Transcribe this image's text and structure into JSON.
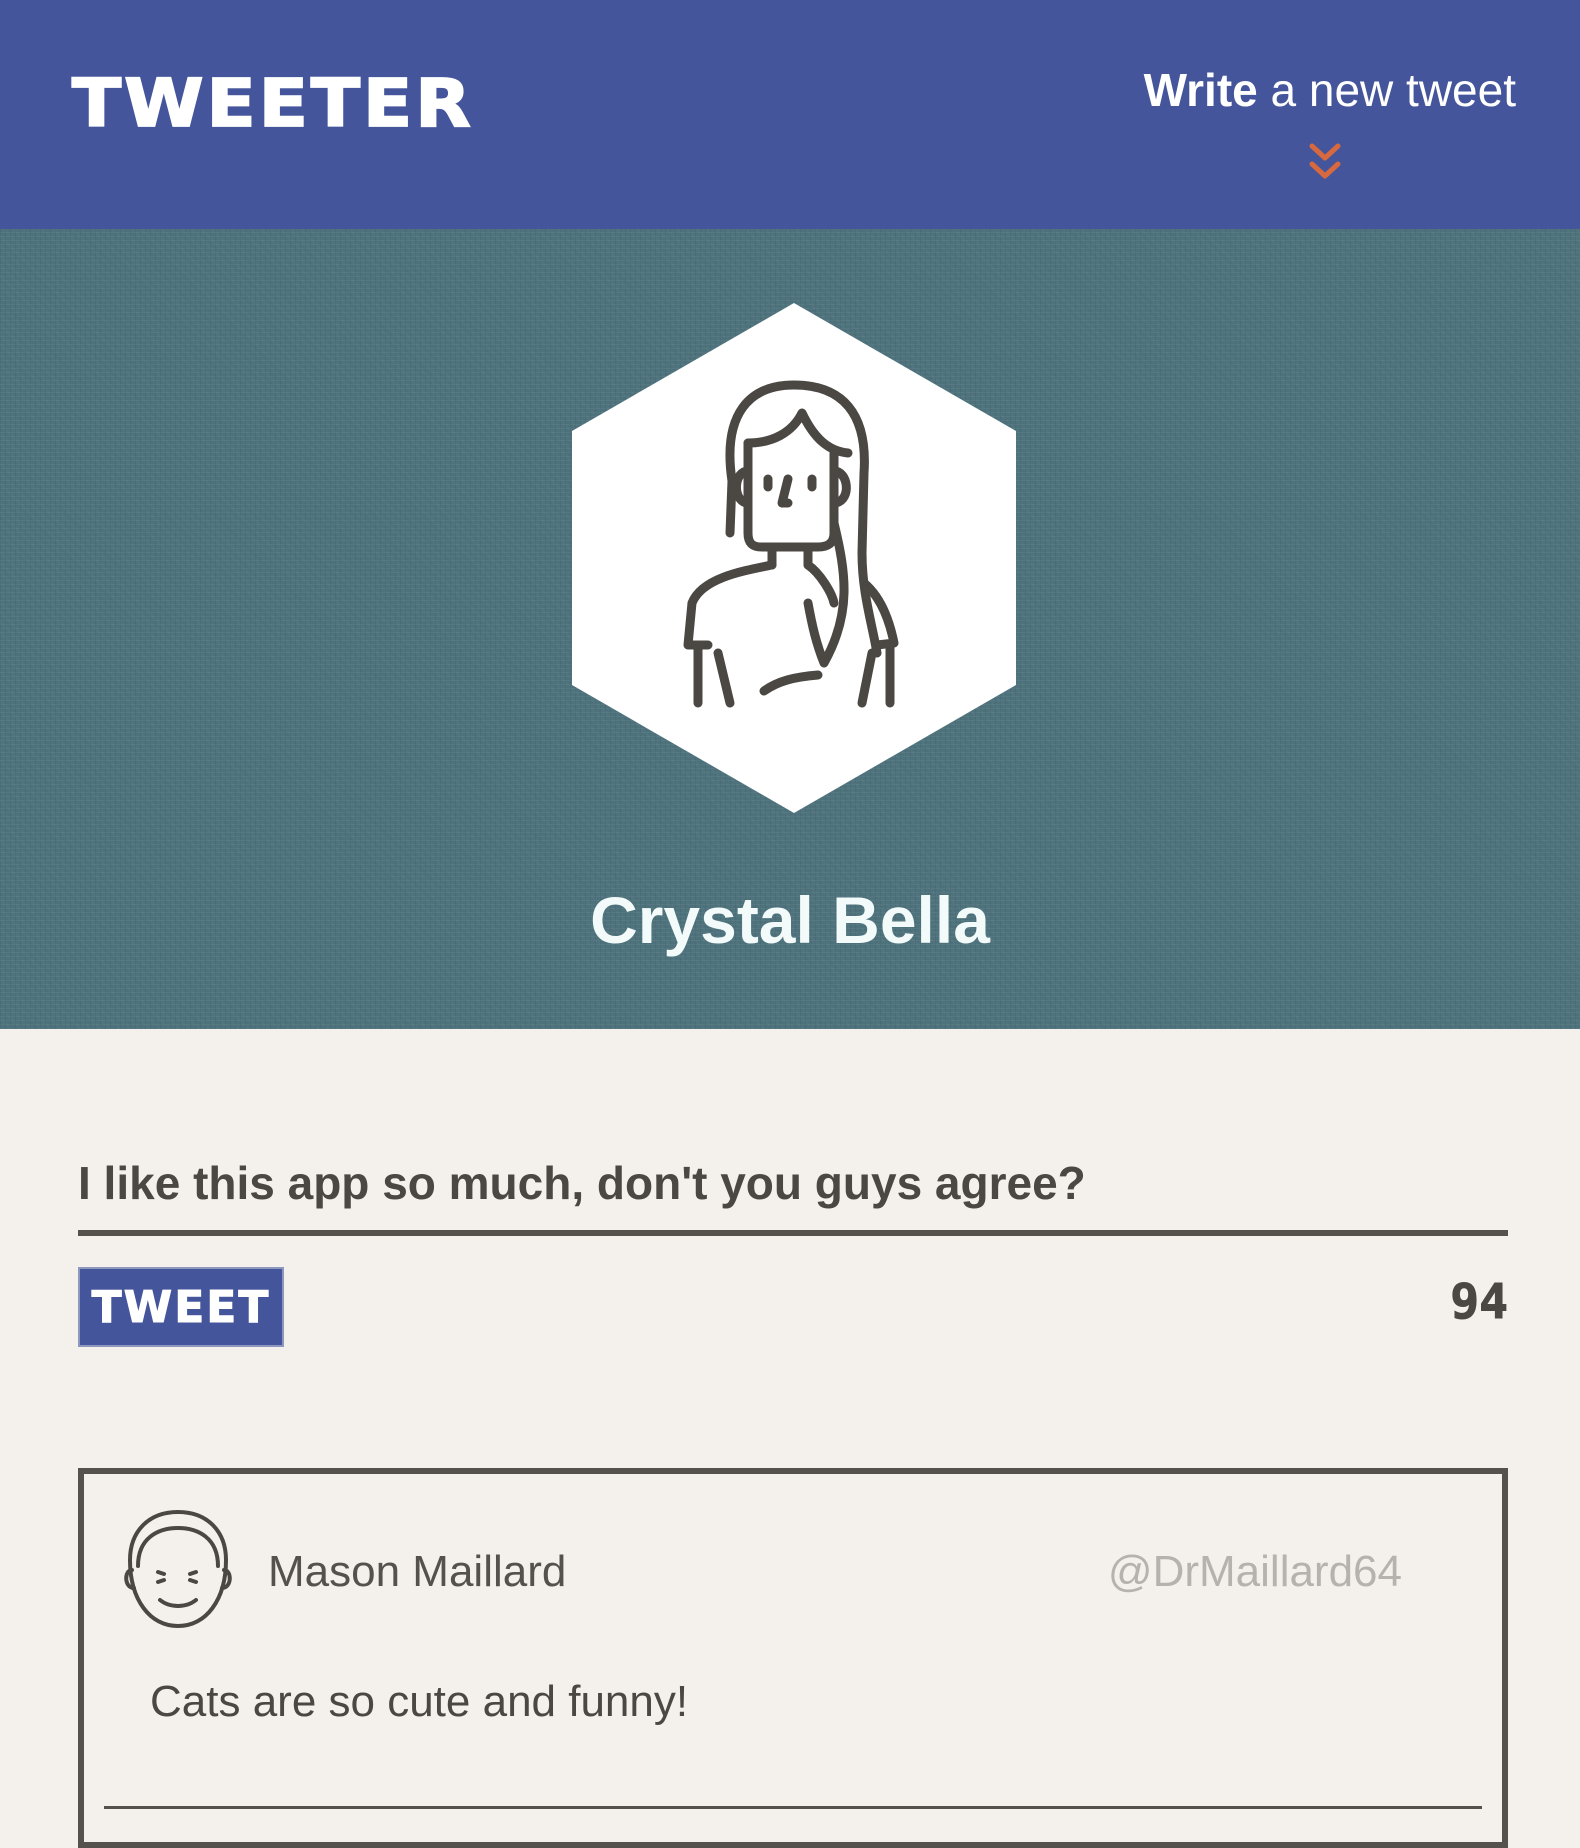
{
  "nav": {
    "brand": "TWEETER",
    "compose_toggle": {
      "strong": "Write",
      "rest": " a new tweet"
    },
    "chevron_icon": "double-chevron-down-icon",
    "chevron_color": "#d8693f",
    "bg_color": "#44559b"
  },
  "profile": {
    "name": "Crystal Bella",
    "avatar_icon": "woman-avatar-icon",
    "banner_color": "#4d727c"
  },
  "compose": {
    "text": "I like this app so much, don't you guys agree?",
    "button_label": "TWEET",
    "counter": "94"
  },
  "tweets": [
    {
      "name": "Mason Maillard",
      "handle": "@DrMaillard64",
      "text": "Cats are so cute and funny!",
      "avatar_icon": "smiling-man-avatar-icon"
    }
  ]
}
